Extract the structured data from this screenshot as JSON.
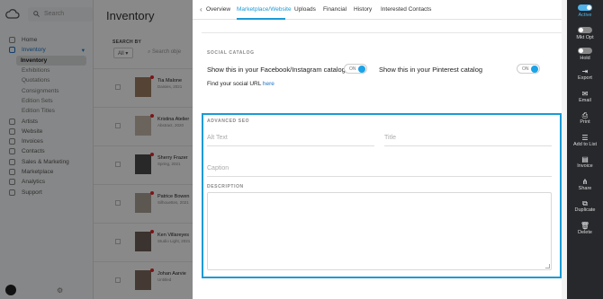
{
  "sidebar": {
    "search_placeholder": "Search",
    "items": [
      {
        "label": "Home"
      },
      {
        "label": "Inventory",
        "active": true
      },
      {
        "label": "Inventory",
        "sub": true,
        "selected": true
      },
      {
        "label": "Exhibitions",
        "sub": true
      },
      {
        "label": "Quotations",
        "sub": true
      },
      {
        "label": "Consignments",
        "sub": true
      },
      {
        "label": "Edition Sets",
        "sub": true
      },
      {
        "label": "Edition Titles",
        "sub": true
      },
      {
        "label": "Artists"
      },
      {
        "label": "Website"
      },
      {
        "label": "Invoices"
      },
      {
        "label": "Contacts"
      },
      {
        "label": "Sales & Marketing"
      },
      {
        "label": "Marketplace"
      },
      {
        "label": "Analytics"
      },
      {
        "label": "Support"
      }
    ]
  },
  "list": {
    "title": "Inventory",
    "search_by_label": "SEARCH BY",
    "filter_value": "All",
    "search_placeholder": "Search obje",
    "rows": [
      {
        "name": "Tia Malone",
        "sub": "Daisies, 2021"
      },
      {
        "name": "Kristina Atelier",
        "sub": "Abstract, 2020"
      },
      {
        "name": "Sherry Frazer",
        "sub": "Spring, 2021"
      },
      {
        "name": "Patrice Bowen",
        "sub": "Silhouettes, 2021"
      },
      {
        "name": "Ken Villareyes",
        "sub": "Studio Light, 2021"
      },
      {
        "name": "Johan Aarvie",
        "sub": "Untitled"
      }
    ]
  },
  "tabs": [
    "Overview",
    "Marketplace/Website",
    "Uploads",
    "Financial",
    "History",
    "Interested Contacts"
  ],
  "social": {
    "section_label": "SOCIAL CATALOG",
    "fb_label": "Show this in your Facebook/Instagram catalog",
    "fb_toggle": "ON",
    "pin_label": "Show this in your Pinterest catalog",
    "pin_toggle": "ON",
    "url_prefix": "Find your social URL",
    "url_link": "here"
  },
  "seo": {
    "section_label": "ADVANCED SEO",
    "alt_text_placeholder": "Alt Text",
    "title_placeholder": "Title",
    "caption_placeholder": "Caption",
    "description_label": "DESCRIPTION"
  },
  "rightbar": {
    "active_label": "Active",
    "mkt_label": "Mkt Opt",
    "hold_label": "Hold",
    "actions": [
      {
        "label": "Export",
        "icon": "export-icon"
      },
      {
        "label": "Email",
        "icon": "email-icon"
      },
      {
        "label": "Print",
        "icon": "print-icon"
      },
      {
        "label": "Add to List",
        "icon": "add-to-list-icon"
      },
      {
        "label": "Invoice",
        "icon": "invoice-icon"
      },
      {
        "label": "Share",
        "icon": "share-icon"
      },
      {
        "label": "Duplicate",
        "icon": "duplicate-icon"
      },
      {
        "label": "Delete",
        "icon": "trash-icon"
      }
    ]
  },
  "colors": {
    "accent": "#1a9ad6",
    "toggle_on": "#1aa3e8",
    "rightbar_bg": "#26282b"
  }
}
